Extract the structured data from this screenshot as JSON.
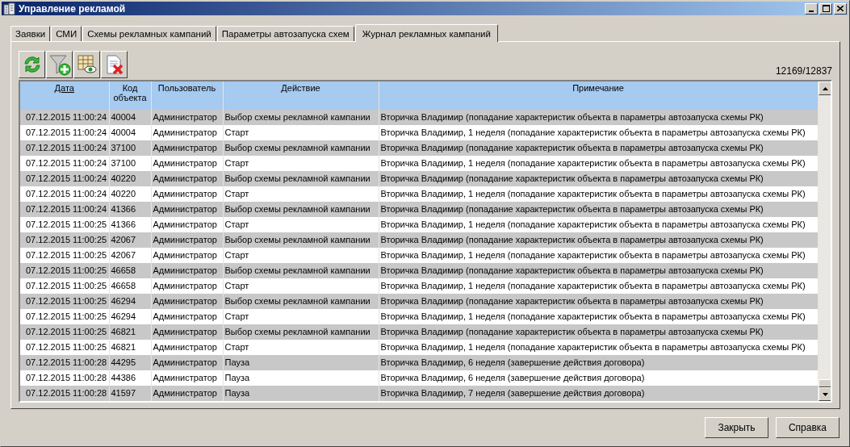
{
  "window": {
    "title": "Управление рекламой"
  },
  "tabs": [
    {
      "label": "Заявки",
      "selected": false
    },
    {
      "label": "СМИ",
      "selected": false
    },
    {
      "label": "Схемы рекламных кампаний",
      "selected": false
    },
    {
      "label": "Параметры автозапуска схем",
      "selected": false
    },
    {
      "label": "Журнал рекламных кампаний",
      "selected": true
    }
  ],
  "toolbar": [
    {
      "kind": "refresh"
    },
    {
      "kind": "filter-add"
    },
    {
      "kind": "grid-view"
    },
    {
      "kind": "delete"
    }
  ],
  "record_count": "12169/12837",
  "table": {
    "columns": [
      {
        "label": "Дата",
        "sorted": true
      },
      {
        "label": "Код объекта",
        "sorted": false
      },
      {
        "label": "Пользователь",
        "sorted": false
      },
      {
        "label": "Действие",
        "sorted": false
      },
      {
        "label": "Примечание",
        "sorted": false
      }
    ],
    "rows": [
      [
        "07.12.2015 11:00:24",
        "40004",
        "Администратор",
        "Выбор схемы рекламной кампании",
        "Вторичка Владимир (попадание характеристик объекта в параметры автозапуска схемы РК)"
      ],
      [
        "07.12.2015 11:00:24",
        "40004",
        "Администратор",
        "Старт",
        "Вторичка Владимир, 1 неделя (попадание характеристик объекта в параметры автозапуска схемы РК)"
      ],
      [
        "07.12.2015 11:00:24",
        "37100",
        "Администратор",
        "Выбор схемы рекламной кампании",
        "Вторичка Владимир (попадание характеристик объекта в параметры автозапуска схемы РК)"
      ],
      [
        "07.12.2015 11:00:24",
        "37100",
        "Администратор",
        "Старт",
        "Вторичка Владимир, 1 неделя (попадание характеристик объекта в параметры автозапуска схемы РК)"
      ],
      [
        "07.12.2015 11:00:24",
        "40220",
        "Администратор",
        "Выбор схемы рекламной кампании",
        "Вторичка Владимир (попадание характеристик объекта в параметры автозапуска схемы РК)"
      ],
      [
        "07.12.2015 11:00:24",
        "40220",
        "Администратор",
        "Старт",
        "Вторичка Владимир, 1 неделя (попадание характеристик объекта в параметры автозапуска схемы РК)"
      ],
      [
        "07.12.2015 11:00:24",
        "41366",
        "Администратор",
        "Выбор схемы рекламной кампании",
        "Вторичка Владимир (попадание характеристик объекта в параметры автозапуска схемы РК)"
      ],
      [
        "07.12.2015 11:00:25",
        "41366",
        "Администратор",
        "Старт",
        "Вторичка Владимир, 1 неделя (попадание характеристик объекта в параметры автозапуска схемы РК)"
      ],
      [
        "07.12.2015 11:00:25",
        "42067",
        "Администратор",
        "Выбор схемы рекламной кампании",
        "Вторичка Владимир (попадание характеристик объекта в параметры автозапуска схемы РК)"
      ],
      [
        "07.12.2015 11:00:25",
        "42067",
        "Администратор",
        "Старт",
        "Вторичка Владимир, 1 неделя (попадание характеристик объекта в параметры автозапуска схемы РК)"
      ],
      [
        "07.12.2015 11:00:25",
        "46658",
        "Администратор",
        "Выбор схемы рекламной кампании",
        "Вторичка Владимир (попадание характеристик объекта в параметры автозапуска схемы РК)"
      ],
      [
        "07.12.2015 11:00:25",
        "46658",
        "Администратор",
        "Старт",
        "Вторичка Владимир, 1 неделя (попадание характеристик объекта в параметры автозапуска схемы РК)"
      ],
      [
        "07.12.2015 11:00:25",
        "46294",
        "Администратор",
        "Выбор схемы рекламной кампании",
        "Вторичка Владимир (попадание характеристик объекта в параметры автозапуска схемы РК)"
      ],
      [
        "07.12.2015 11:00:25",
        "46294",
        "Администратор",
        "Старт",
        "Вторичка Владимир, 1 неделя (попадание характеристик объекта в параметры автозапуска схемы РК)"
      ],
      [
        "07.12.2015 11:00:25",
        "46821",
        "Администратор",
        "Выбор схемы рекламной кампании",
        "Вторичка Владимир (попадание характеристик объекта в параметры автозапуска схемы РК)"
      ],
      [
        "07.12.2015 11:00:25",
        "46821",
        "Администратор",
        "Старт",
        "Вторичка Владимир, 1 неделя (попадание характеристик объекта в параметры автозапуска схемы РК)"
      ],
      [
        "07.12.2015 11:00:28",
        "44295",
        "Администратор",
        "Пауза",
        "Вторичка Владимир, 6 неделя (завершение действия договора)"
      ],
      [
        "07.12.2015 11:00:28",
        "44386",
        "Администратор",
        "Пауза",
        "Вторичка Владимир, 6 неделя (завершение действия договора)"
      ],
      [
        "07.12.2015 11:00:28",
        "41597",
        "Администратор",
        "Пауза",
        "Вторичка Владимир, 7 неделя (завершение действия договора)"
      ]
    ]
  },
  "buttons": [
    "Закрыть",
    "Справка"
  ]
}
